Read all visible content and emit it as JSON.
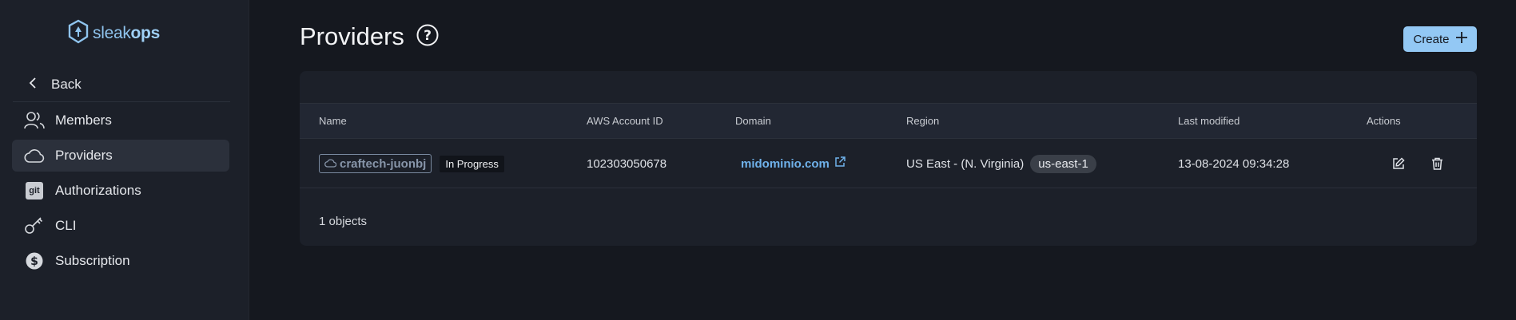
{
  "brand": {
    "light": "sleak",
    "bold": "ops"
  },
  "sidebar": {
    "back_label": "Back",
    "items": [
      {
        "label": "Members",
        "icon": "members-icon"
      },
      {
        "label": "Providers",
        "icon": "cloud-icon",
        "active": true
      },
      {
        "label": "Authorizations",
        "icon": "git-icon",
        "icon_text": "git"
      },
      {
        "label": "CLI",
        "icon": "key-icon"
      },
      {
        "label": "Subscription",
        "icon": "dollar-icon"
      }
    ]
  },
  "header": {
    "title": "Providers",
    "help_icon": "help-icon",
    "create_label": "Create"
  },
  "table": {
    "columns": [
      "Name",
      "AWS Account ID",
      "Domain",
      "Region",
      "Last modified",
      "Actions"
    ],
    "rows": [
      {
        "name": "craftech-juonbj",
        "status": "In Progress",
        "aws_account_id": "102303050678",
        "domain": "midominio.com",
        "region": "US East - (N. Virginia)",
        "region_code": "us-east-1",
        "last_modified": "13-08-2024 09:34:28"
      }
    ],
    "footer": "1 objects"
  },
  "colors": {
    "accent": "#93c8f4",
    "link": "#6fb1ea",
    "background": "#15181f",
    "sidebar": "#1c2029"
  }
}
